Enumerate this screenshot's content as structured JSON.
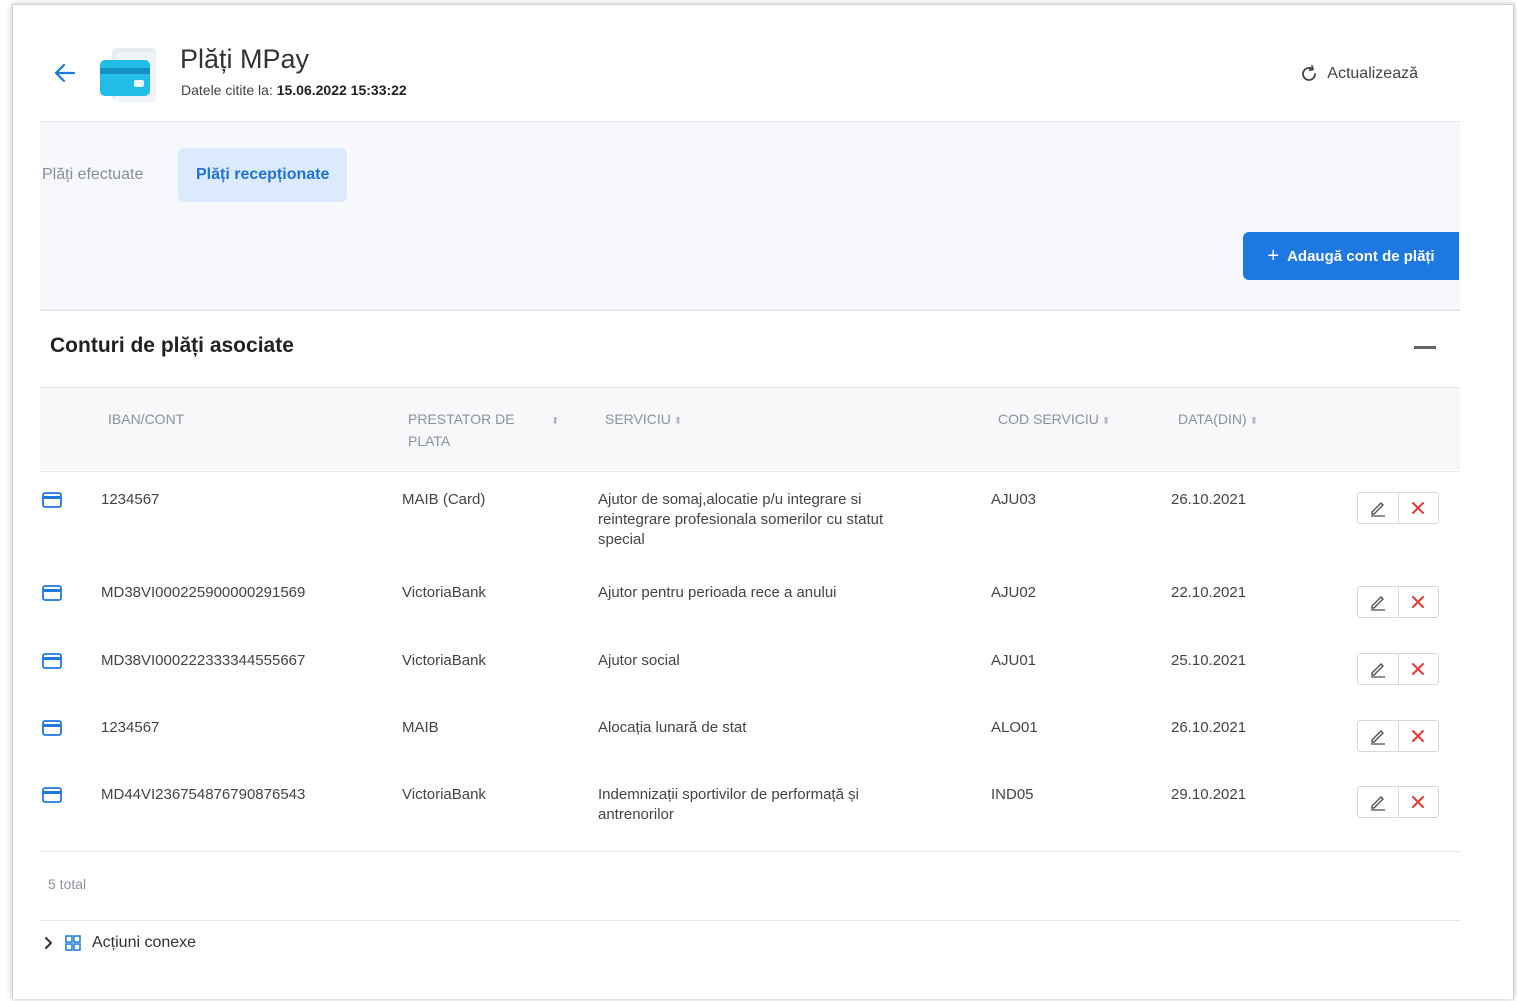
{
  "header": {
    "title": "Plăți MPay",
    "subtitle_label": "Datele citite la:",
    "subtitle_value": "15.06.2022 15:33:22",
    "refresh_label": "Actualizează"
  },
  "tabs": [
    {
      "label": "Plăți efectuate",
      "active": false
    },
    {
      "label": "Plăți recepționate",
      "active": true
    }
  ],
  "add_button_label": "Adaugă cont de plăți",
  "section_title": "Conturi de plăți asociate",
  "table": {
    "headers": {
      "iban": "IBAN/CONT",
      "prestator": "PRESTATOR DE PLATA",
      "serviciu": "SERVICIU",
      "cod": "COD SERVICIU",
      "data": "DATA(DIN)"
    },
    "rows": [
      {
        "iban": "1234567",
        "prestator": "MAIB (Card)",
        "serviciu": "Ajutor de somaj,alocatie p/u integrare si reintegrare profesionala somerilor cu statut special",
        "cod": "AJU03",
        "data": "26.10.2021"
      },
      {
        "iban": "MD38VI000225900000291569",
        "prestator": "VictoriaBank",
        "serviciu": "Ajutor pentru perioada rece a anului",
        "cod": "AJU02",
        "data": "22.10.2021"
      },
      {
        "iban": "MD38VI000222333344555667",
        "prestator": "VictoriaBank",
        "serviciu": "Ajutor social",
        "cod": "AJU01",
        "data": "25.10.2021"
      },
      {
        "iban": "1234567",
        "prestator": "MAIB",
        "serviciu": "Alocația lunară de stat",
        "cod": "ALO01",
        "data": "26.10.2021"
      },
      {
        "iban": "MD44VI236754876790876543",
        "prestator": "VictoriaBank",
        "serviciu": "Indemnizații sportivilor de performață și antrenorilor",
        "cod": "IND05",
        "data": "29.10.2021"
      }
    ]
  },
  "total_label": "5 total",
  "related_actions_label": "Acțiuni conexe",
  "colors": {
    "accent": "#1e78e2",
    "active_tab_bg": "#dbeafd",
    "delete_red": "#e53935"
  }
}
